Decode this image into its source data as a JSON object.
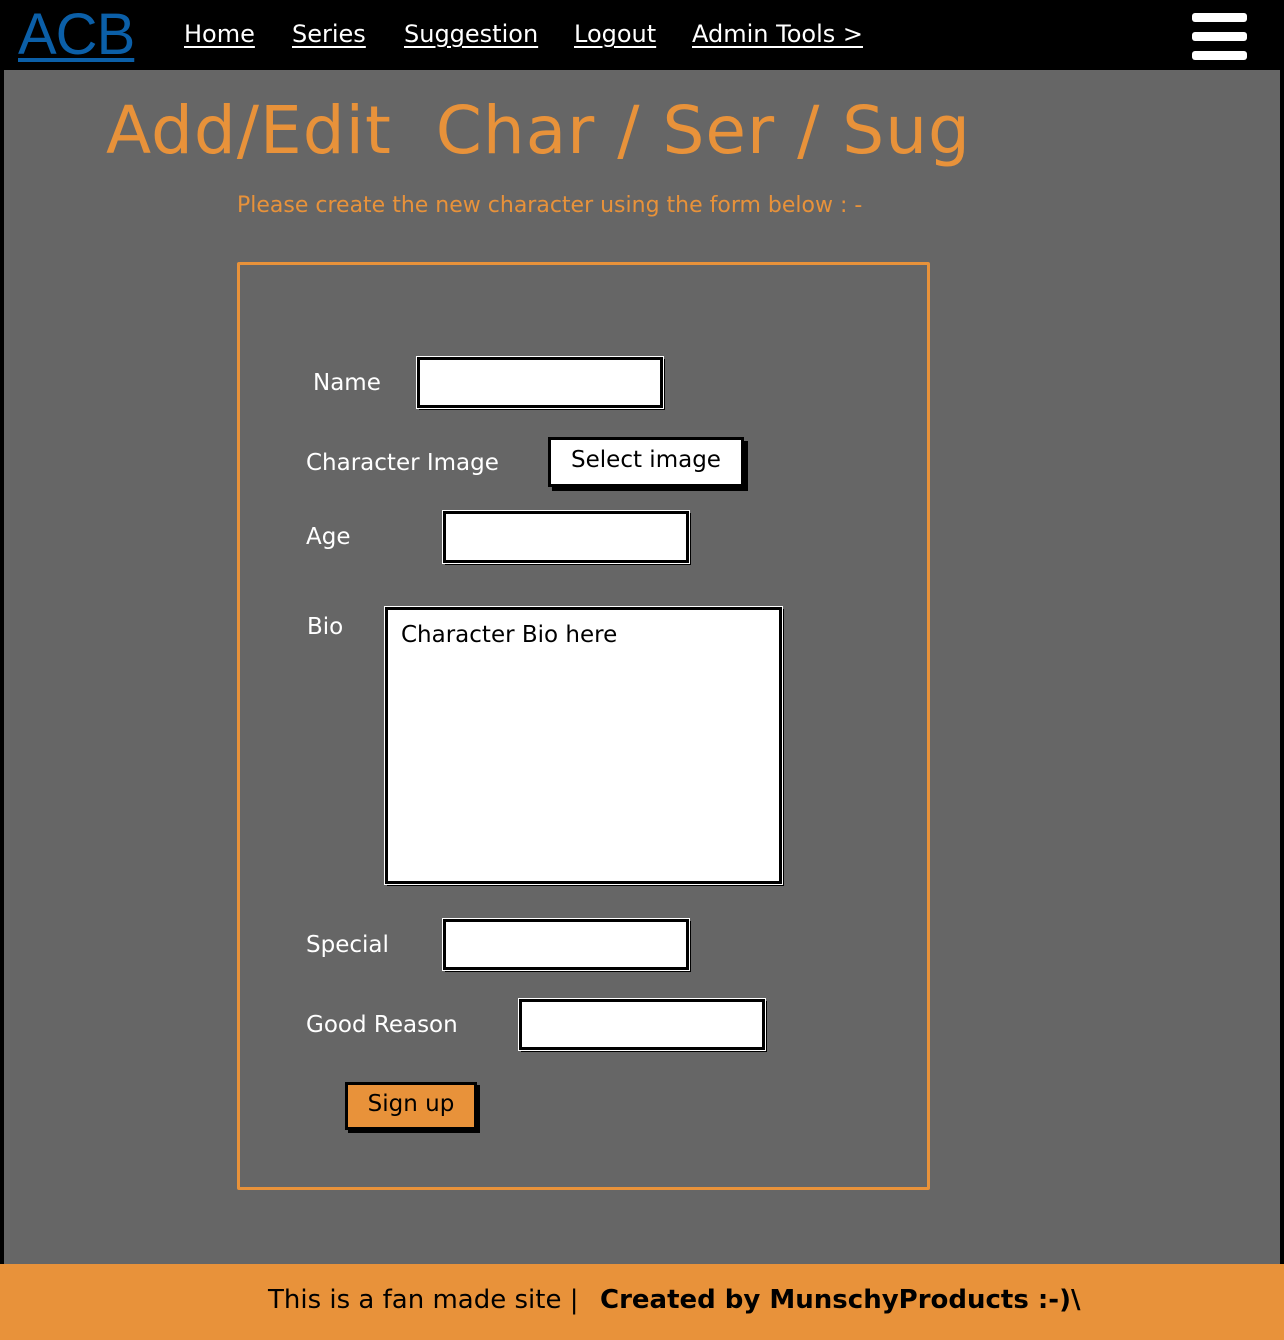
{
  "header": {
    "logo": "ACB",
    "nav": {
      "home": "Home",
      "series": "Series",
      "suggestion": "Suggestion",
      "logout": "Logout",
      "admin_tools": "Admin Tools >"
    },
    "menu_icon": "hamburger-menu-icon"
  },
  "main": {
    "title": "Add/Edit  Char / Ser / Sug",
    "subtitle": "Please create the new character using the form below : -"
  },
  "form": {
    "name_label": "Name",
    "name_value": "",
    "image_label": "Character Image",
    "image_button": "Select image",
    "age_label": "Age",
    "age_value": "",
    "bio_label": "Bio",
    "bio_value": "Character Bio here",
    "special_label": "Special",
    "special_value": "",
    "reason_label": "Good Reason",
    "reason_value": "",
    "submit_label": "Sign up"
  },
  "footer": {
    "note": "This is a fan made site |",
    "credit": "Created by MunschyProducts :-)\\"
  },
  "colors": {
    "accent": "#e8923a",
    "background": "#666666",
    "navbar": "#000000",
    "logo": "#0b5fa8"
  }
}
